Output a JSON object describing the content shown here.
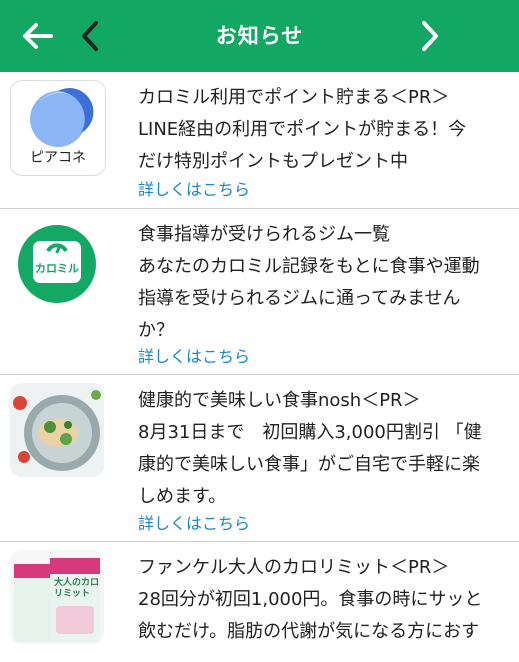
{
  "header": {
    "title": "お知らせ"
  },
  "items": [
    {
      "thumb_label": "ピアコネ",
      "lines": [
        "カロミル利用でポイント貯まる＜PR＞",
        "LINE経由の利用でポイントが貯まる！今",
        "だけ特別ポイントもプレゼント中"
      ],
      "link": "詳しくはこちら"
    },
    {
      "thumb_label": "カロミル",
      "lines": [
        "食事指導が受けられるジム一覧",
        "あなたのカロミル記録をもとに食事や運動",
        "指導を受けられるジムに通ってみません",
        "か？"
      ],
      "link": "詳しくはこちら"
    },
    {
      "lines": [
        "健康的で美味しい食事nosh＜PR＞",
        "8月31日まで　初回購入3,000円割引 「健",
        "康的で美味しい食事」がご自宅で手軽に楽",
        "しめます。"
      ],
      "link": "詳しくはこちら"
    },
    {
      "thumb_label": "大人のカロリミット",
      "lines": [
        "ファンケル大人のカロリミット＜PR＞",
        "28回分が初回1,000円。食事の時にサッと",
        "飲むだけ。脂肪の代謝が気になる方におす"
      ]
    }
  ]
}
